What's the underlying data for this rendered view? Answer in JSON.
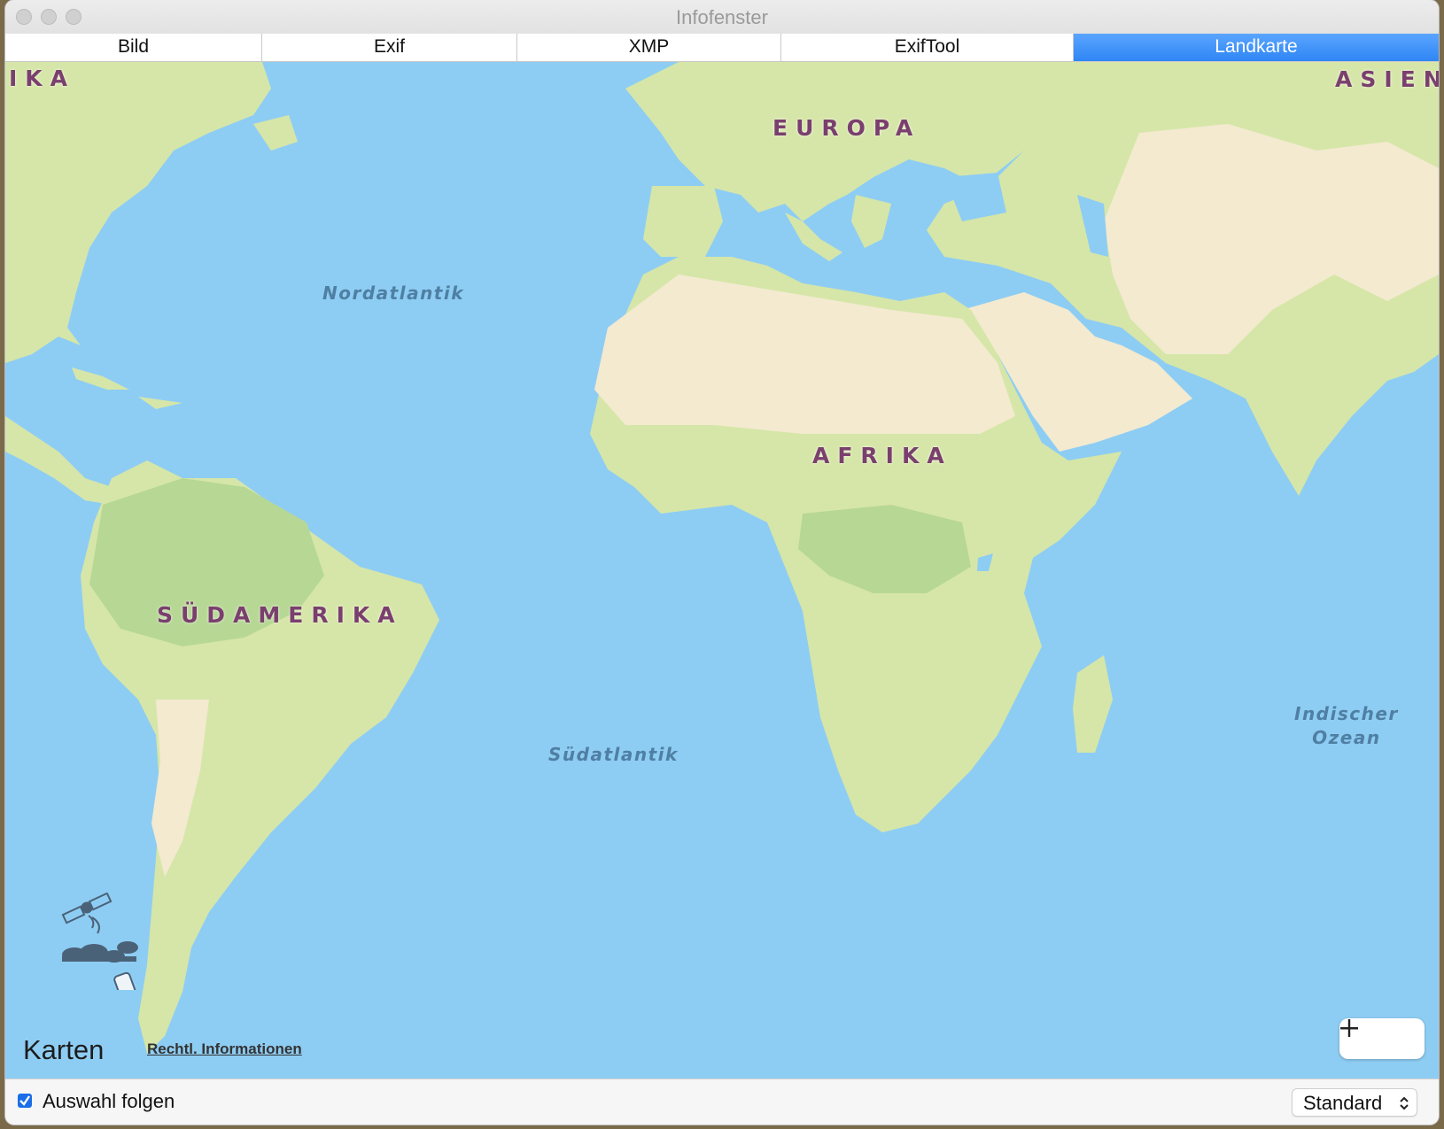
{
  "window": {
    "title": "Infofenster"
  },
  "tabs": [
    {
      "label": "Bild",
      "active": false
    },
    {
      "label": "Exif",
      "active": false
    },
    {
      "label": "XMP",
      "active": false
    },
    {
      "label": "ExifTool",
      "active": false
    },
    {
      "label": "Landkarte",
      "active": true
    }
  ],
  "map": {
    "continents": [
      "IKA",
      "EUROPA",
      "ASIEN",
      "AFRIKA",
      "SÜDAMERIKA"
    ],
    "oceans": {
      "north_atlantic": "Nordatlantik",
      "south_atlantic": "Südatlantik",
      "indian_ocean_line1": "Indischer",
      "indian_ocean_line2": "Ozean"
    },
    "attribution": {
      "logo_text": "Karten",
      "legal_link": "Rechtl. Informationen"
    },
    "colors": {
      "water": "#8ecdf3",
      "land_green": "#d6e6a8",
      "land_sand": "#f3ead0",
      "forest": "#b7d795"
    }
  },
  "footer": {
    "follow_selection_label": "Auswahl folgen",
    "follow_selection_checked": true,
    "map_type_value": "Standard"
  }
}
